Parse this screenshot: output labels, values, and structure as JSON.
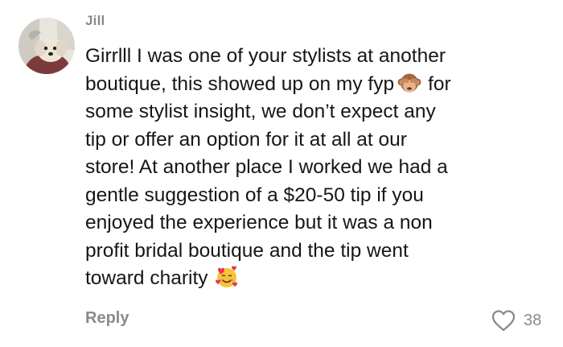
{
  "comment": {
    "author": "Jill",
    "avatar_icon": "dog-avatar-icon",
    "body_lines": [
      "Girrlll I was one of your stylists at another",
      "boutique, this showed up on my fyp",
      "for",
      "some stylist insight, we don’t expect any",
      "tip or offer an option for it at all at our",
      "store! At another place I worked we had a",
      "gentle suggestion of a $20-50 tip if you",
      "enjoyed the experience but it was a non",
      "profit bridal boutique and the tip went",
      "toward charity"
    ],
    "emojis": [
      "see-no-evil-monkey-icon",
      "smiling-face-with-hearts-icon"
    ]
  },
  "footer": {
    "reply_label": "Reply",
    "like_count": "38",
    "like_icon": "heart-outline-icon"
  },
  "colors": {
    "text": "#161616",
    "muted": "#8a8a8a",
    "background": "#ffffff"
  }
}
